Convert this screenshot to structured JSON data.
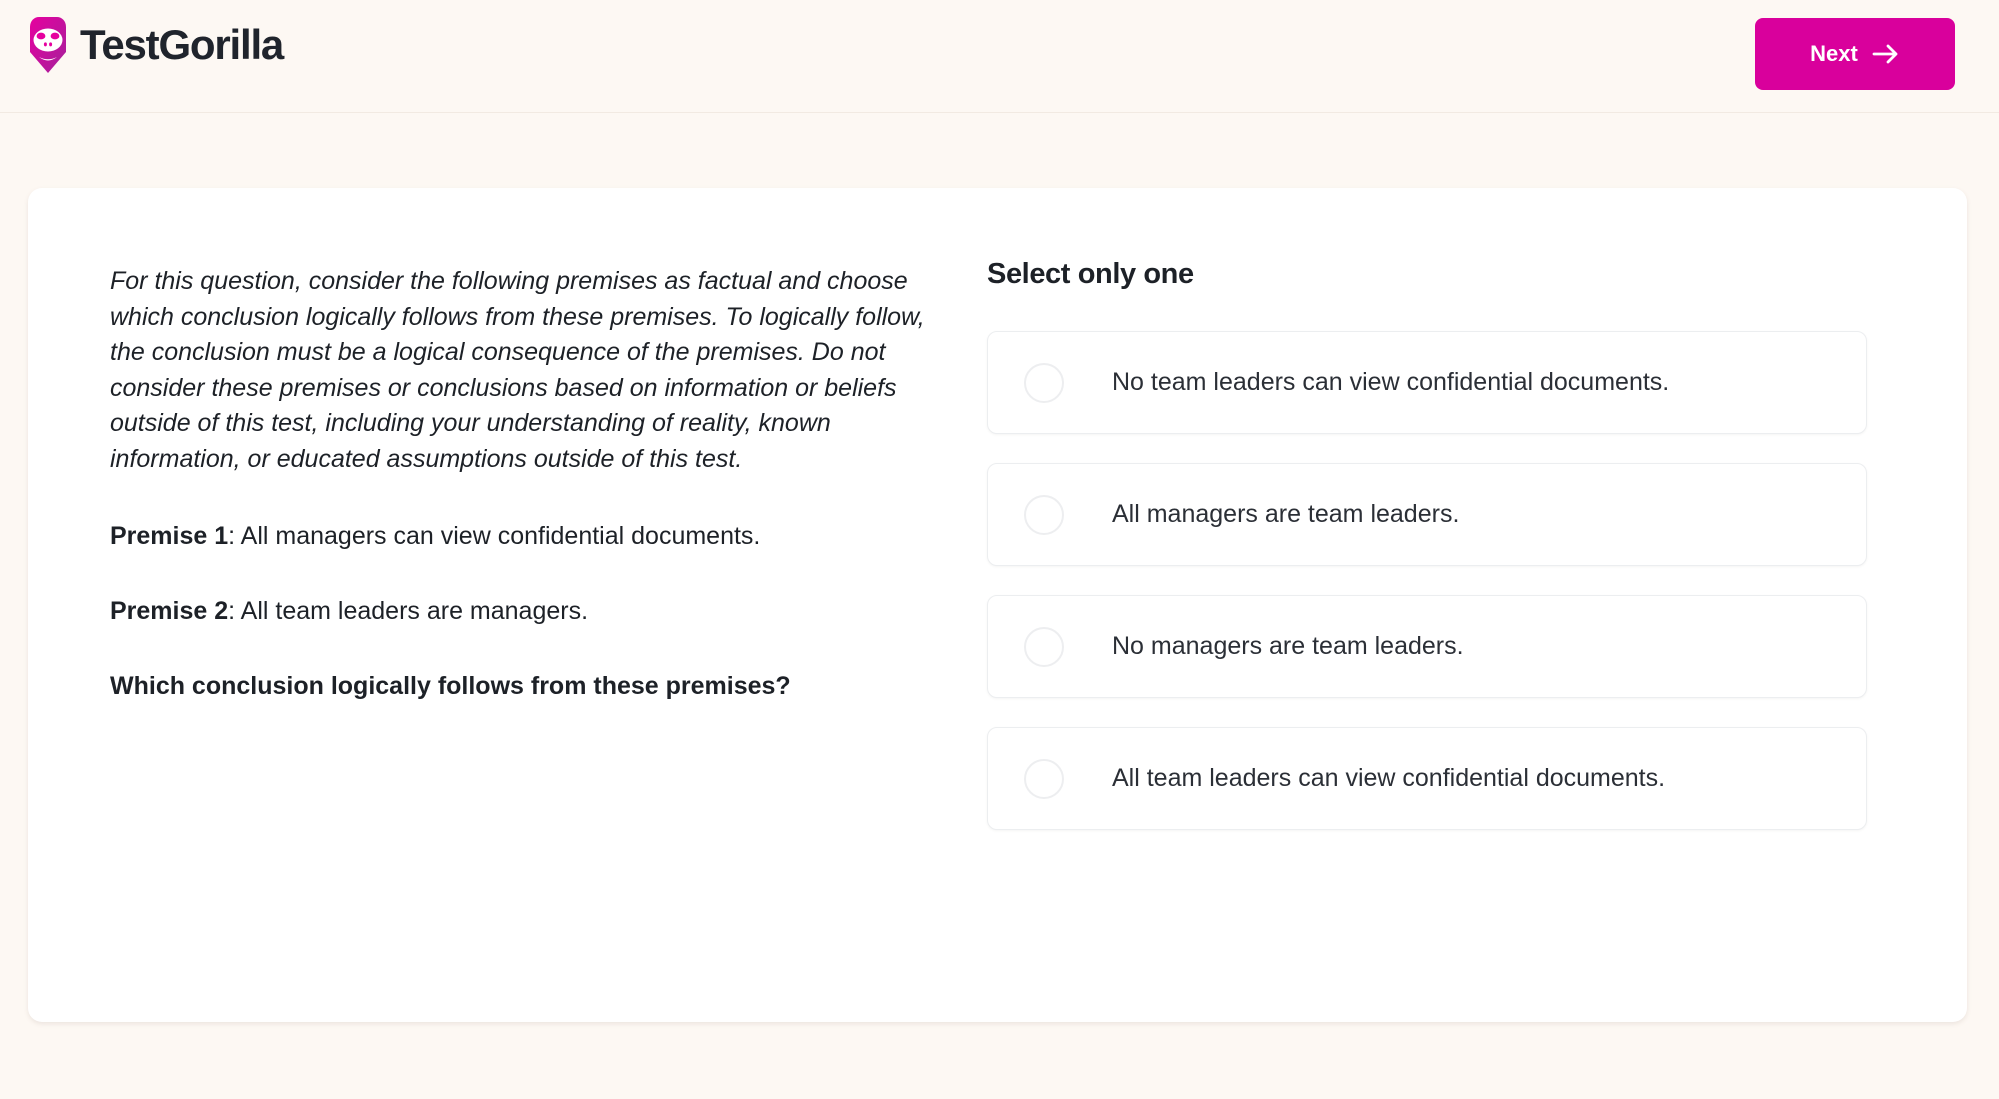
{
  "header": {
    "brand_name": "TestGorilla",
    "logo_icon": "gorilla-logo-icon",
    "next_label": "Next",
    "next_icon": "arrow-right-icon"
  },
  "question": {
    "intro": "For this question, consider the following premises as factual and choose which conclusion logically follows from these premises. To logically follow, the conclusion must be a logical consequence of the premises. Do not consider these premises or conclusions based on information or beliefs outside of this test, including your understanding of reality, known information, or educated assumptions outside of this test.",
    "premise_1_label": "Premise 1",
    "premise_1_text": ": All managers can view confidential documents.",
    "premise_2_label": "Premise 2",
    "premise_2_text": ": All team leaders are managers.",
    "prompt": "Which conclusion logically follows from these premises?"
  },
  "answers": {
    "title": "Select only one",
    "options": [
      {
        "label": "No team leaders can view confidential documents.",
        "selected": false
      },
      {
        "label": "All managers are team leaders.",
        "selected": false
      },
      {
        "label": "No managers are team leaders.",
        "selected": false
      },
      {
        "label": "All team leaders can view confidential documents.",
        "selected": false
      }
    ]
  },
  "colors": {
    "brand_magenta": "#d9009c",
    "page_background": "#fdf8f3",
    "card_background": "#ffffff",
    "text_primary": "#1d2127",
    "option_border": "#eceef0"
  }
}
